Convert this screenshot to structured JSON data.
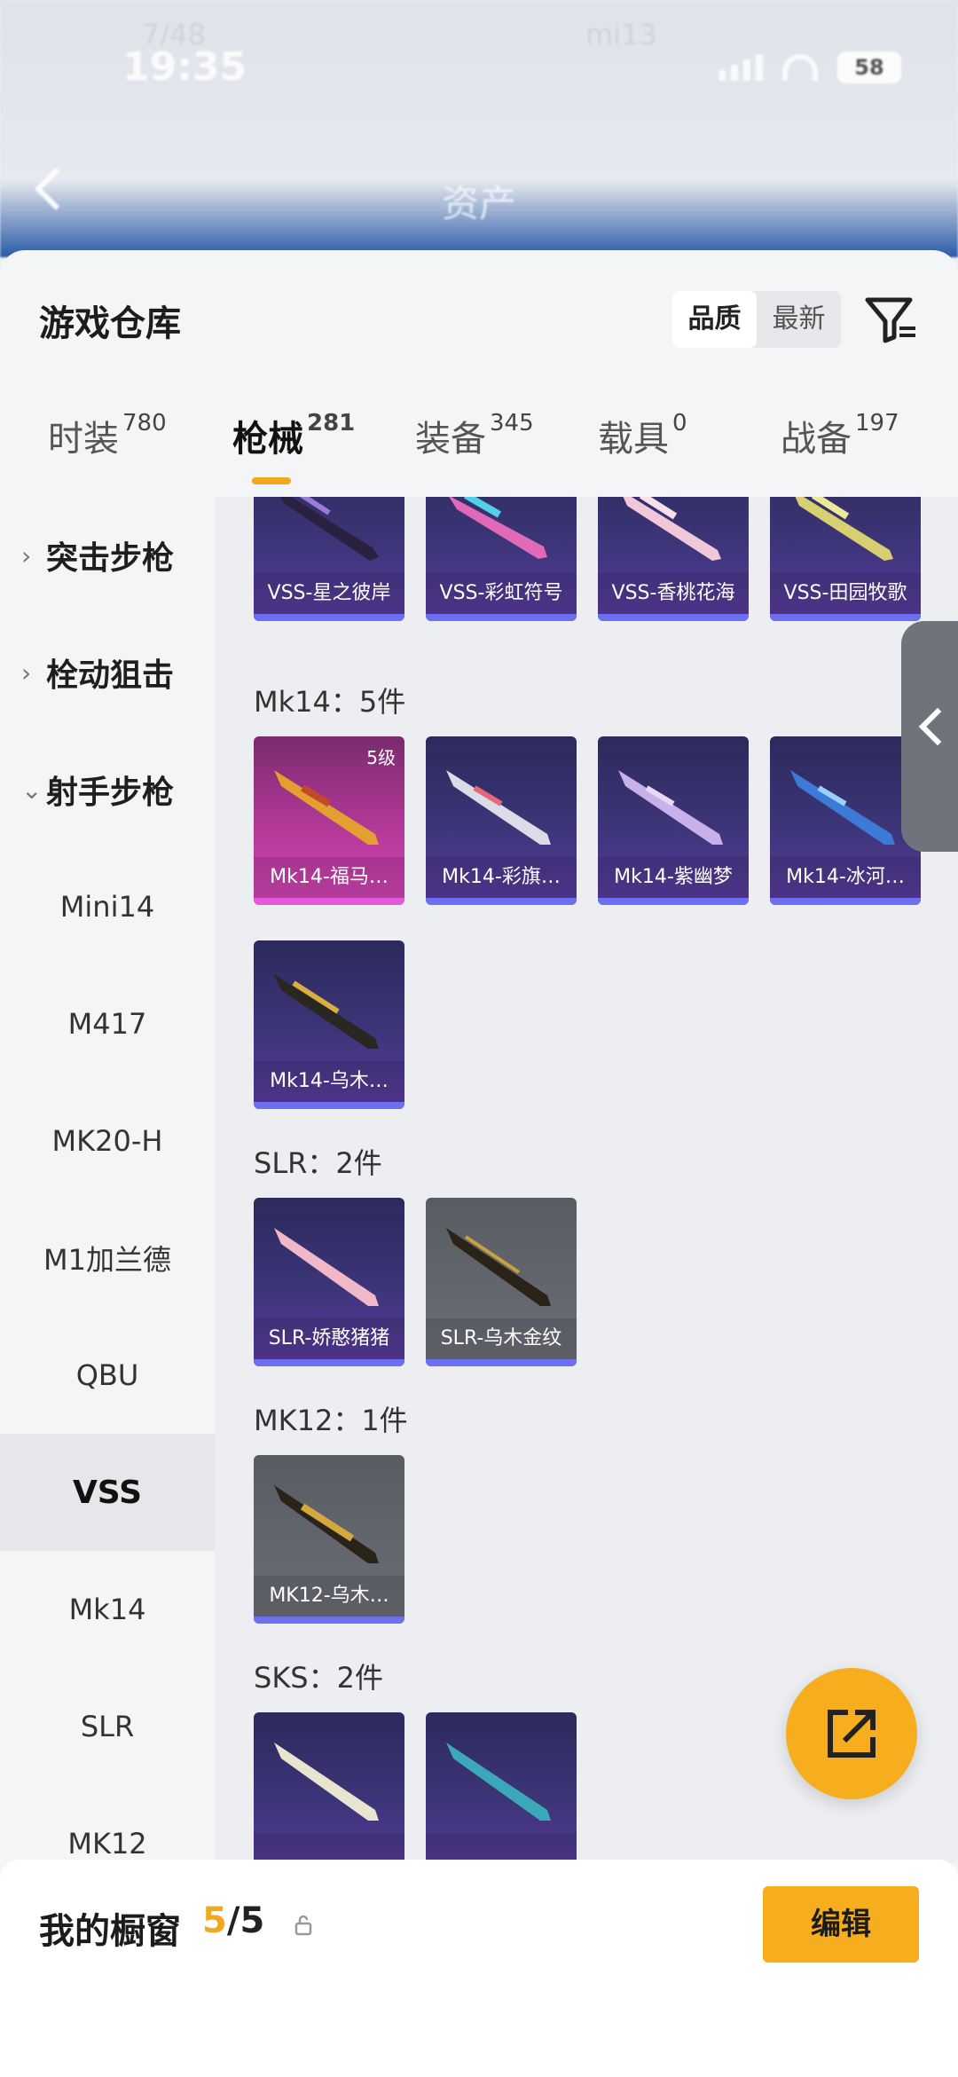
{
  "status_bar": {
    "time": "19:35",
    "battery": "58",
    "blurred_left": "7/48",
    "blurred_mid": "mi13"
  },
  "header": {
    "title": "资产"
  },
  "sheet": {
    "title": "游戏仓库",
    "sort_options": [
      "品质",
      "最新"
    ],
    "tabs": [
      {
        "label": "时装",
        "count": "780"
      },
      {
        "label": "枪械",
        "count": "281"
      },
      {
        "label": "装备",
        "count": "345"
      },
      {
        "label": "载具",
        "count": "0"
      },
      {
        "label": "战备",
        "count": "197"
      }
    ]
  },
  "sidebar": {
    "groups": [
      {
        "label": "突击步枪",
        "chevron": "›"
      },
      {
        "label": "栓动狙击",
        "chevron": "›"
      },
      {
        "label": "射手步枪",
        "chevron": "⌄"
      }
    ],
    "items": [
      "Mini14",
      "M417",
      "MK20-H",
      "M1加兰德",
      "QBU",
      "VSS",
      "Mk14",
      "SLR",
      "MK12"
    ]
  },
  "content": {
    "sections": [
      {
        "label": "",
        "cards": [
          "VSS-星之彼岸",
          "VSS-彩虹符号",
          "VSS-香桃花海",
          "VSS-田园牧歌"
        ]
      },
      {
        "label": "Mk14：5件",
        "cards": [
          "Mk14-福马…",
          "Mk14-彩旗…",
          "Mk14-紫幽梦",
          "Mk14-冰河…",
          "Mk14-乌木…"
        ],
        "first_level": "5级"
      },
      {
        "label": "SLR：2件",
        "cards": [
          "SLR-娇憨猪猪",
          "SLR-乌木金纹"
        ]
      },
      {
        "label": "MK12：1件",
        "cards": [
          "MK12-乌木…"
        ]
      },
      {
        "label": "SKS：2件",
        "cards": [
          "",
          ""
        ]
      }
    ]
  },
  "showcase": {
    "title": "我的橱窗",
    "current": "5",
    "total": "/5",
    "edit_label": "编辑"
  },
  "colors": {
    "accent": "#f3a81b",
    "card_purple": "#3d3579",
    "card_gray": "#63656d"
  }
}
